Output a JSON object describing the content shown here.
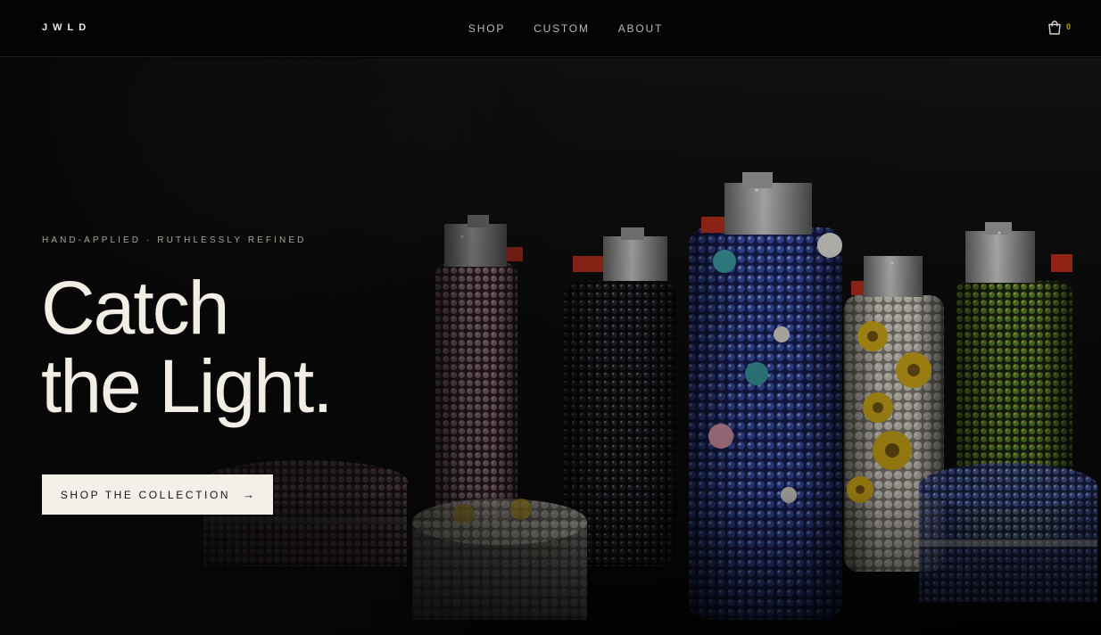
{
  "header": {
    "logo": "JWLD",
    "nav": [
      {
        "label": "SHOP"
      },
      {
        "label": "CUSTOM"
      },
      {
        "label": "ABOUT"
      }
    ],
    "cart": {
      "icon": "shopping-bag-icon",
      "count": "0"
    }
  },
  "hero": {
    "eyebrow": "HAND-APPLIED · RUTHLESSLY REFINED",
    "headline_line1": "Catch",
    "headline_line2": "the Light.",
    "cta_label": "SHOP THE COLLECTION",
    "cta_icon": "arrow-right-icon"
  },
  "colors": {
    "background": "#060606",
    "text_primary": "#f2eee6",
    "accent": "#c9a227",
    "cta_bg": "#f3f0ea"
  }
}
